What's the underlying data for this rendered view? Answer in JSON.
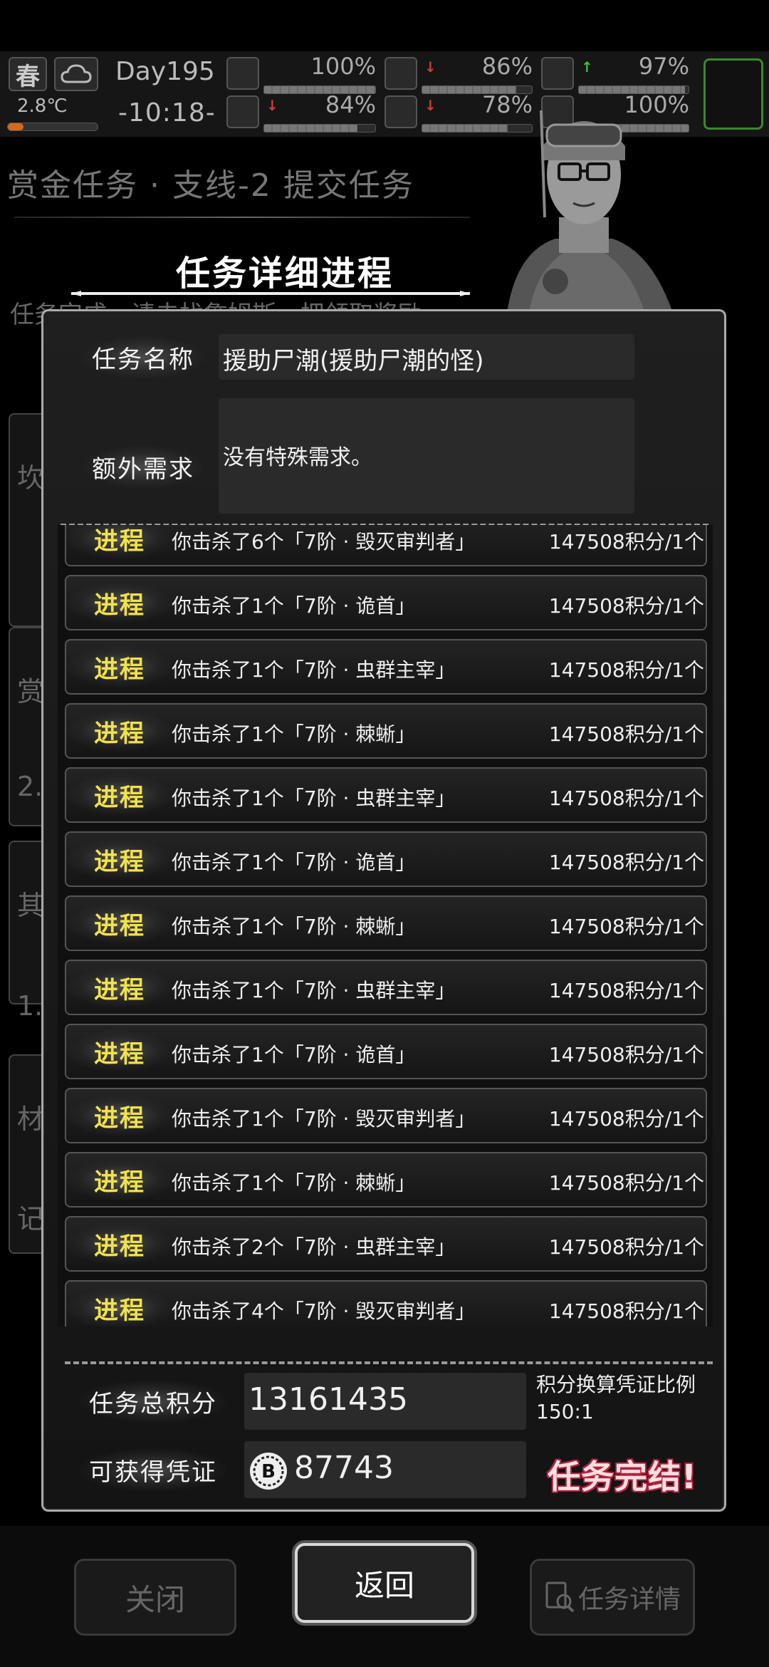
{
  "status": {
    "season": "春",
    "temperature": "2.8℃",
    "day": "Day195",
    "time": "-10:18-",
    "stats": [
      {
        "icon": "medkit-icon",
        "value": "100%",
        "level": 1.0,
        "arrow": ""
      },
      {
        "icon": "stomach-icon",
        "value": "86%",
        "level": 0.86,
        "arrow": "down"
      },
      {
        "icon": "lungs-icon",
        "value": "97%",
        "level": 0.97,
        "arrow": "up"
      },
      {
        "icon": "boot-icon",
        "value": "84%",
        "level": 0.84,
        "arrow": "down"
      },
      {
        "icon": "water-drop-icon",
        "value": "78%",
        "level": 0.78,
        "arrow": "down"
      },
      {
        "icon": "energy-icon",
        "value": "100%",
        "level": 1.0,
        "arrow": ""
      }
    ]
  },
  "background": {
    "title": "赏金任务 · 支线-2 提交任务",
    "description": "任务完成，请去找詹姆斯，把领取奖励",
    "side_chars": [
      "坎",
      "赏",
      "2.",
      "其",
      "1.",
      "材",
      "记"
    ]
  },
  "dialog": {
    "title": "任务详细进程",
    "name_label": "任务名称",
    "name_value": "援助尸潮(援助尸潮的怪)",
    "extra_label": "额外需求",
    "extra_value": "没有特殊需求。",
    "progress_tag": "进程",
    "progress": [
      {
        "desc": "你击杀了6个「7阶 · 毁灭审判者」",
        "points": "147508积分/1个"
      },
      {
        "desc": "你击杀了1个「7阶 · 诡首」",
        "points": "147508积分/1个"
      },
      {
        "desc": "你击杀了1个「7阶 · 虫群主宰」",
        "points": "147508积分/1个"
      },
      {
        "desc": "你击杀了1个「7阶 · 棘蜥」",
        "points": "147508积分/1个"
      },
      {
        "desc": "你击杀了1个「7阶 · 虫群主宰」",
        "points": "147508积分/1个"
      },
      {
        "desc": "你击杀了1个「7阶 · 诡首」",
        "points": "147508积分/1个"
      },
      {
        "desc": "你击杀了1个「7阶 · 棘蜥」",
        "points": "147508积分/1个"
      },
      {
        "desc": "你击杀了1个「7阶 · 虫群主宰」",
        "points": "147508积分/1个"
      },
      {
        "desc": "你击杀了1个「7阶 · 诡首」",
        "points": "147508积分/1个"
      },
      {
        "desc": "你击杀了1个「7阶 · 毁灭审判者」",
        "points": "147508积分/1个"
      },
      {
        "desc": "你击杀了1个「7阶 · 棘蜥」",
        "points": "147508积分/1个"
      },
      {
        "desc": "你击杀了2个「7阶 · 虫群主宰」",
        "points": "147508积分/1个"
      },
      {
        "desc": "你击杀了4个「7阶 · 毁灭审判者」",
        "points": "147508积分/1个"
      }
    ],
    "total_label": "任务总积分",
    "total_value": "13161435",
    "ratio_label": "积分换算凭证比例",
    "ratio_value": "150:1",
    "voucher_label": "可获得凭证",
    "voucher_value": "87743",
    "complete_text": "任务完结!"
  },
  "buttons": {
    "close": "关闭",
    "back": "返回",
    "detail": "任务详情"
  }
}
